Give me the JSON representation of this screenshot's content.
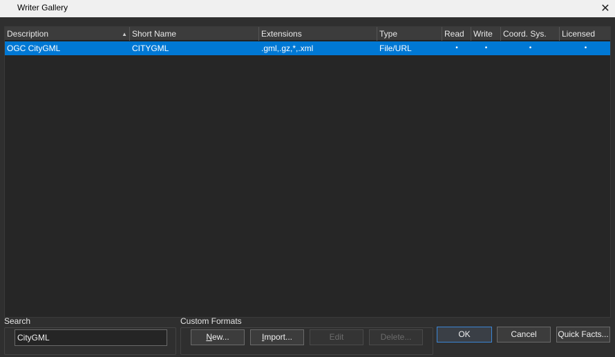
{
  "window": {
    "title": "Writer Gallery",
    "close_glyph": "✕"
  },
  "table": {
    "columns": [
      "Description",
      "Short Name",
      "Extensions",
      "Type",
      "Read",
      "Write",
      "Coord. Sys.",
      "Licensed"
    ],
    "sorted_column": "Description",
    "sort_direction": "ascending",
    "rows": [
      {
        "description": "OGC CityGML",
        "short_name": "CITYGML",
        "extensions": ".gml,.gz,*,.xml",
        "type": "File/URL",
        "read": "•",
        "write": "•",
        "coord_sys": "•",
        "licensed": "•",
        "selected": true
      }
    ]
  },
  "search": {
    "label": "Search",
    "value": "CityGML"
  },
  "custom_formats": {
    "label": "Custom Formats",
    "new_mnemonic": "N",
    "new_rest": "ew...",
    "import_mnemonic": "I",
    "import_rest": "mport...",
    "edit_label": "Edit",
    "delete_label": "Delete..."
  },
  "buttons": {
    "ok": "OK",
    "cancel": "Cancel",
    "quick_facts": "Quick Facts..."
  },
  "colors": {
    "selection": "#0078d4",
    "background": "#2f2f2f",
    "titlebar": "#f0f0f0"
  }
}
